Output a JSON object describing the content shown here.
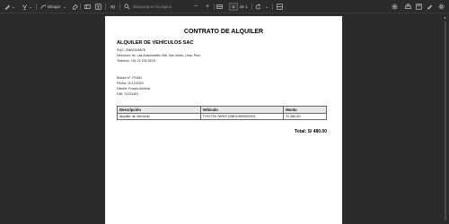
{
  "toolbar": {
    "draw_label": "Dibujar",
    "search_placeholder": "Búsqueda en la página",
    "page_number": "1",
    "page_of": "de 1",
    "zoom_out_symbol": "−",
    "zoom_in_symbol": "+"
  },
  "document": {
    "title": "CONTRATO DE ALQUILER",
    "company_name": "ALQUILER DE VEHÍCULOS SAC",
    "ruc": "RUC: 20602345678",
    "address": "Dirección: Av. Las Automóviles 456, San Isidro, Lima, Perú",
    "phone": "Teléfono: +51 01 234 5678",
    "ticket": "Boleta N°: PO361",
    "date": "Fecha: 11/12/2024",
    "client": "Cliente: Franco Abreda",
    "dni": "DNI: 74123451",
    "table": {
      "headers": [
        "Descripción",
        "Vehículo",
        "Monto"
      ],
      "rows": [
        [
          "Alquiler de Vehículo",
          "TOYOTA YARIS (SBDUH8SKD0H)",
          "S/ 480.00"
        ]
      ]
    },
    "total": "Total: S/ 480.00"
  }
}
